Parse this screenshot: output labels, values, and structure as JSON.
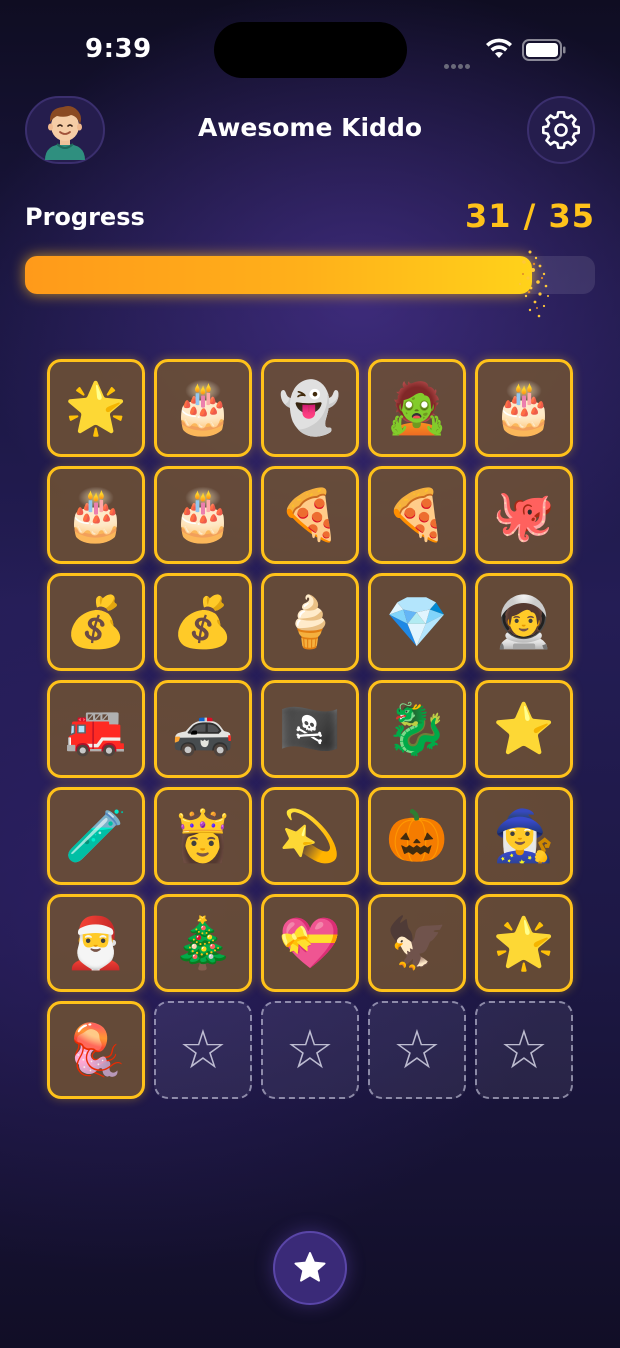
{
  "status_bar": {
    "time": "9:39"
  },
  "header": {
    "title": "Awesome Kiddo",
    "avatar_icon": "boy-avatar-icon",
    "settings_icon": "gear-icon"
  },
  "progress": {
    "label": "Progress",
    "count_text": "31 / 35",
    "current": 31,
    "total": 35,
    "bar_fill_fraction": 0.89,
    "fill_color": "#ffb01a"
  },
  "stickers": [
    {
      "name": "glowing-star",
      "glyph": "🌟",
      "collected": true
    },
    {
      "name": "birthday-cake",
      "glyph": "🎂",
      "collected": true
    },
    {
      "name": "ghost",
      "glyph": "👻",
      "collected": true
    },
    {
      "name": "zombie",
      "glyph": "🧟",
      "collected": true
    },
    {
      "name": "birthday-cake",
      "glyph": "🎂",
      "collected": true
    },
    {
      "name": "birthday-cake",
      "glyph": "🎂",
      "collected": true
    },
    {
      "name": "birthday-cake",
      "glyph": "🎂",
      "collected": true
    },
    {
      "name": "pizza",
      "glyph": "🍕",
      "collected": true
    },
    {
      "name": "pizza",
      "glyph": "🍕",
      "collected": true
    },
    {
      "name": "octopus",
      "glyph": "🐙",
      "collected": true
    },
    {
      "name": "treasure-chest",
      "glyph": "💰",
      "collected": true
    },
    {
      "name": "treasure-chest",
      "glyph": "💰",
      "collected": true
    },
    {
      "name": "ice-cream",
      "glyph": "🍦",
      "collected": true
    },
    {
      "name": "crystals",
      "glyph": "💎",
      "collected": true
    },
    {
      "name": "astronaut",
      "glyph": "🧑‍🚀",
      "collected": true
    },
    {
      "name": "fire-truck",
      "glyph": "🚒",
      "collected": true
    },
    {
      "name": "police-car",
      "glyph": "🚓",
      "collected": true
    },
    {
      "name": "pirate-ship",
      "glyph": "🏴‍☠️",
      "collected": true
    },
    {
      "name": "dragon",
      "glyph": "🐉",
      "collected": true
    },
    {
      "name": "star",
      "glyph": "⭐",
      "collected": true
    },
    {
      "name": "cauldron",
      "glyph": "🧪",
      "collected": true
    },
    {
      "name": "princess",
      "glyph": "👸",
      "collected": true
    },
    {
      "name": "dizzy-star",
      "glyph": "💫",
      "collected": true
    },
    {
      "name": "jack-o-lantern",
      "glyph": "🎃",
      "collected": true
    },
    {
      "name": "witch",
      "glyph": "🧙‍♀️",
      "collected": true
    },
    {
      "name": "santa",
      "glyph": "🎅",
      "collected": true
    },
    {
      "name": "christmas-tree",
      "glyph": "🎄",
      "collected": true
    },
    {
      "name": "heart-with-ribbon",
      "glyph": "💝",
      "collected": true
    },
    {
      "name": "eagle",
      "glyph": "🦅",
      "collected": true
    },
    {
      "name": "glowing-star",
      "glyph": "🌟",
      "collected": true
    },
    {
      "name": "jellyfish",
      "glyph": "🪼",
      "collected": true
    },
    {
      "name": "empty-slot",
      "glyph": "☆",
      "collected": false
    },
    {
      "name": "empty-slot",
      "glyph": "☆",
      "collected": false
    },
    {
      "name": "empty-slot",
      "glyph": "☆",
      "collected": false
    },
    {
      "name": "empty-slot",
      "glyph": "☆",
      "collected": false
    }
  ],
  "bottom_button": {
    "icon": "star-icon"
  }
}
